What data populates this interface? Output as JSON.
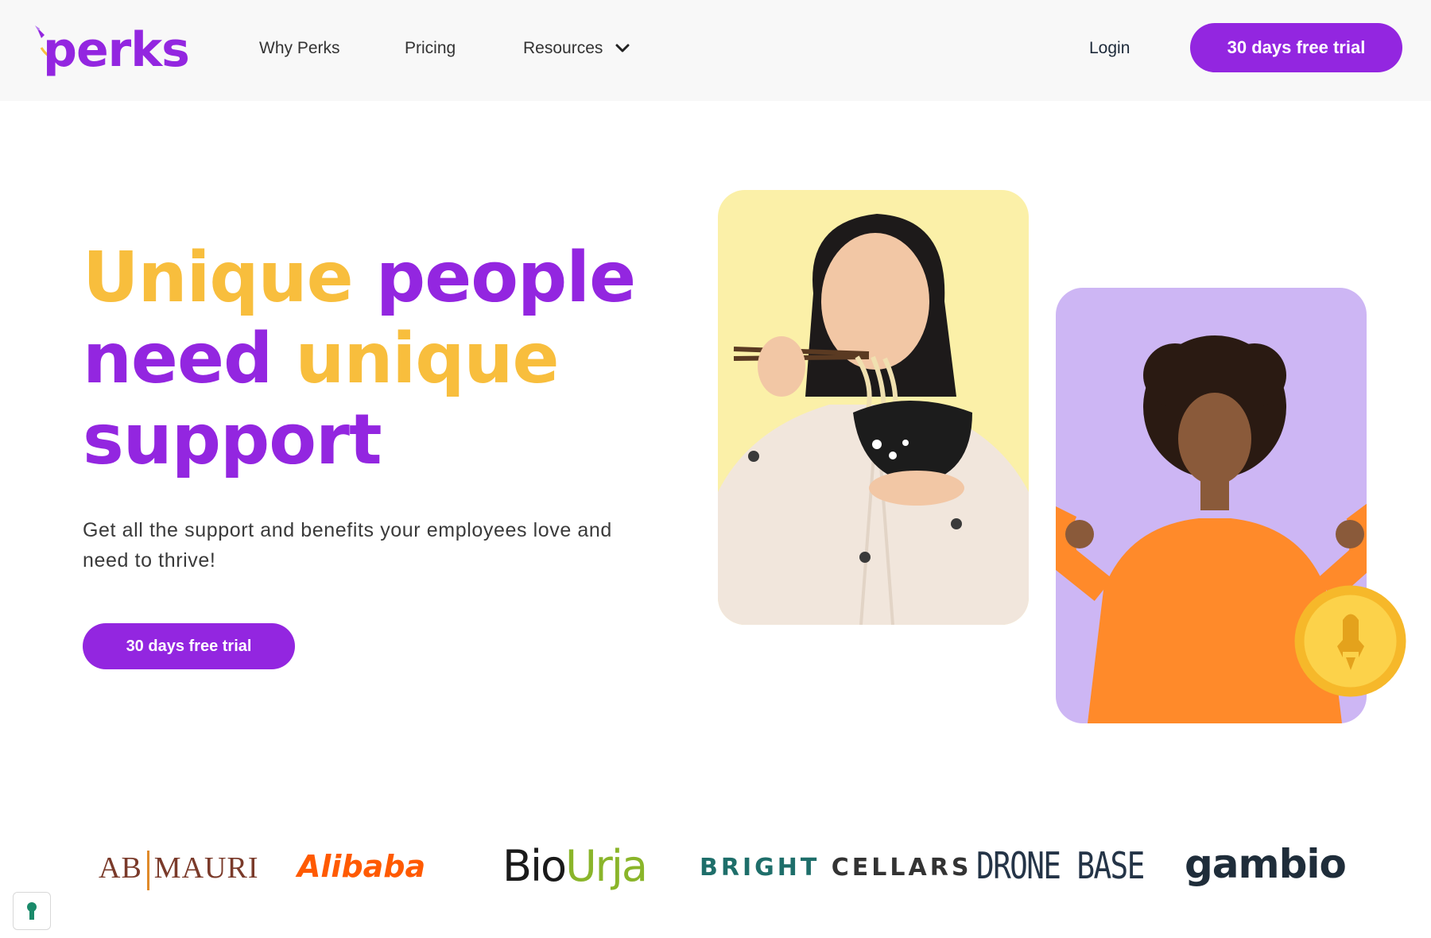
{
  "nav": {
    "logo_text": "perks",
    "links": [
      "Why Perks",
      "Pricing",
      "Resources"
    ],
    "login": "Login",
    "cta": "30 days free trial"
  },
  "hero": {
    "headline": [
      "Unique",
      "people",
      "need",
      "unique",
      "support"
    ],
    "subtitle": "Get all the support and benefits your employees love and need to thrive!",
    "cta": "30 days free trial"
  },
  "logos": {
    "abmauri": [
      "AB",
      "MAURI"
    ],
    "alibaba": "Alibaba",
    "biourja": [
      "Bio",
      "Urja"
    ],
    "brightcellars": [
      "BRIGHT",
      "CELLARS"
    ],
    "dronebase": "DRONE BASE",
    "gambio": "gambio"
  },
  "colors": {
    "brand_purple": "#9326e0",
    "headline_yellow": "#f8be3d",
    "card_yellow": "#fbf0a8",
    "card_purple": "#cdb6f4"
  },
  "icons": [
    "rocket-icon",
    "chevron-down-icon",
    "coin-rocket-icon",
    "cookie-keyhole-icon"
  ]
}
